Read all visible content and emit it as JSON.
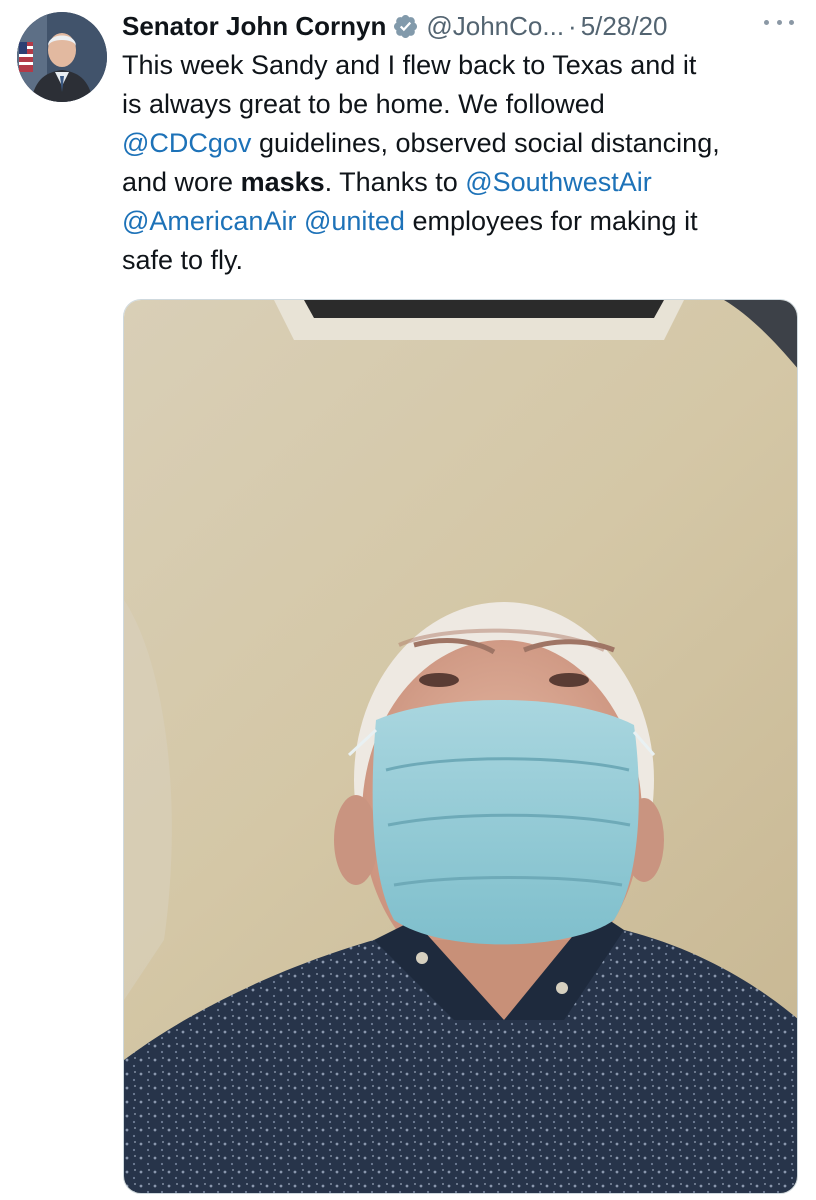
{
  "tweet": {
    "display_name": "Senator John Cornyn",
    "handle": "@JohnCo...",
    "separator": "·",
    "date": "5/28/20",
    "verified_icon": "verified-badge-icon",
    "more_icon": "more-options-icon",
    "text": {
      "line1": "This week Sandy and I flew back to Texas and it",
      "line2": "is always great to be home. We followed",
      "line3_mention": "@CDCgov",
      "line3_rest": " guidelines, observed social distancing,",
      "line4_a": "and wore ",
      "line4_bold": "masks",
      "line4_b": ". Thanks to ",
      "line4_mention": "@SouthwestAir",
      "line5_mention1": "@AmericanAir",
      "line5_space": " ",
      "line5_mention2": "@united",
      "line5_rest": " employees for making it",
      "line6": "safe to fly."
    }
  },
  "colors": {
    "link": "#1d72b8",
    "secondary_text": "#536471",
    "verified_badge": "#829aab"
  }
}
